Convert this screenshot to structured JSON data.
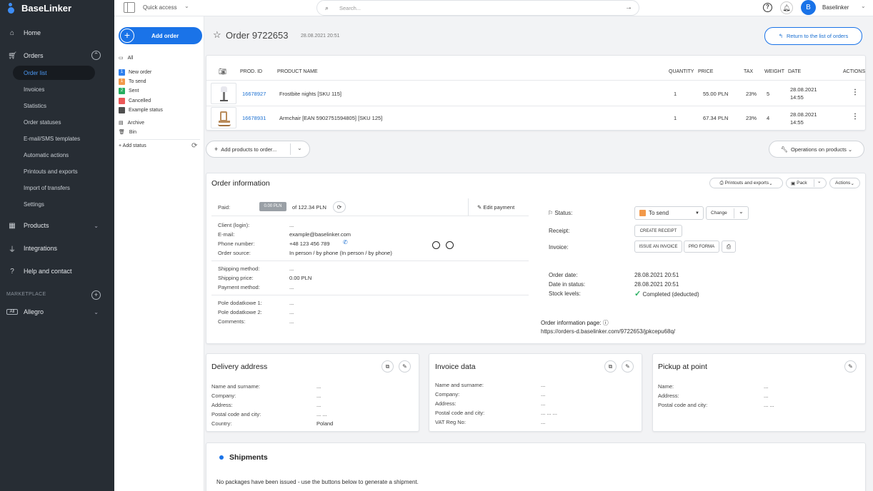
{
  "app": {
    "name": "BaseLinker"
  },
  "sidebar": {
    "home": "Home",
    "orders": "Orders",
    "orders_sub": [
      "Order list",
      "Invoices",
      "Statistics",
      "Order statuses",
      "E-mail/SMS templates",
      "Automatic actions",
      "Printouts and exports",
      "Import of transfers",
      "Settings"
    ],
    "products": "Products",
    "integrations": "Integrations",
    "help": "Help and contact",
    "marketplace_label": "MARKETPLACE",
    "allegro_badge": "All",
    "allegro": "Allegro"
  },
  "topbar": {
    "quick_access": "Quick access",
    "search_placeholder": "Search...",
    "user_initial": "B",
    "user_name": "Baselinker"
  },
  "status_panel": {
    "add_order": "Add order",
    "all": "All",
    "statuses": [
      {
        "num": "1",
        "label": "New order",
        "color": "#2f80ed"
      },
      {
        "num": "1",
        "label": "To send",
        "color": "#f2994a"
      },
      {
        "num": "2",
        "label": "Sent",
        "color": "#27ae60"
      },
      {
        "num": "",
        "label": "Cancelled",
        "color": "#eb5757"
      },
      {
        "num": "",
        "label": "Example status",
        "color": "#4f4f4f"
      }
    ],
    "archive": "Archive",
    "bin": "Bin",
    "add_status": "+ Add status"
  },
  "order_header": {
    "title": "Order 9722653",
    "date": "28.08.2021 20:51",
    "return_button": "Return to the list of orders"
  },
  "products_table": {
    "headers": [
      "PROD. ID",
      "PRODUCT NAME",
      "QUANTITY",
      "PRICE",
      "TAX",
      "WEIGHT",
      "DATE",
      "ACTIONS"
    ],
    "rows": [
      {
        "id": "16678927",
        "name": "Frostbite nights [SKU 115]",
        "qty": "1",
        "price": "55.00 PLN",
        "tax": "23%",
        "weight": "5",
        "date": "28.08.2021",
        "time": "14:55"
      },
      {
        "id": "16678931",
        "name": "Armchair [EAN 5902751594805] [SKU 125]",
        "qty": "1",
        "price": "67.34 PLN",
        "tax": "23%",
        "weight": "4",
        "date": "28.08.2021",
        "time": "14:55"
      }
    ],
    "add_products": "Add products to order...",
    "operations": "Operations on products"
  },
  "order_info": {
    "title": "Order information",
    "printouts_btn": "Printouts and exports",
    "pack_btn": "Pack",
    "actions_btn": "Actions",
    "paid_label": "Paid:",
    "paid_amount": "0.00 PLN",
    "paid_of": "of 122.34 PLN",
    "edit_payment": "Edit payment",
    "client_login_label": "Client (login):",
    "client_login": "...",
    "email_label": "E-mail:",
    "email": "example@baselinker.com",
    "phone_label": "Phone number:",
    "phone": "+48 123 456 789",
    "source_label": "Order source:",
    "source": "In person / by phone (In person / by phone)",
    "ship_method_label": "Shipping method:",
    "ship_method": "...",
    "ship_price_label": "Shipping price:",
    "ship_price": "0.00 PLN",
    "pay_method_label": "Payment method:",
    "pay_method": "...",
    "extra1_label": "Pole dodatkowe 1:",
    "extra1": "...",
    "extra2_label": "Pole dodatkowe 2:",
    "extra2": "...",
    "comments_label": "Comments:",
    "comments": "...",
    "status_label": "Status:",
    "status_value": "To send",
    "change_btn": "Change",
    "receipt_label": "Receipt:",
    "create_receipt": "CREATE RECEIPT",
    "invoice_label": "Invoice:",
    "issue_invoice": "ISSUE AN INVOICE",
    "pro_forma": "PRO FORMA",
    "order_date_label": "Order date:",
    "order_date": "28.08.2021 20:51",
    "date_status_label": "Date in status:",
    "date_status": "28.08.2021 20:51",
    "stock_label": "Stock levels:",
    "stock": "Completed (deducted)",
    "info_page_label": "Order information page:",
    "info_page_url": "https://orders-d.baselinker.com/9722653/jpkcepu68q/"
  },
  "delivery": {
    "title": "Delivery address",
    "fields": [
      {
        "label": "Name and surname:",
        "value": "..."
      },
      {
        "label": "Company:",
        "value": "..."
      },
      {
        "label": "Address:",
        "value": "..."
      },
      {
        "label": "Postal code and city:",
        "value": "...     ..."
      },
      {
        "label": "Country:",
        "value": "Poland"
      }
    ]
  },
  "invoice_data": {
    "title": "Invoice data",
    "fields": [
      {
        "label": "Name and surname:",
        "value": "..."
      },
      {
        "label": "Company:",
        "value": "..."
      },
      {
        "label": "Address:",
        "value": "..."
      },
      {
        "label": "Postal code and city:",
        "value": "...     ...     ..."
      },
      {
        "label": "VAT Reg No:",
        "value": "..."
      }
    ]
  },
  "pickup": {
    "title": "Pickup at point",
    "fields": [
      {
        "label": "Name:",
        "value": "..."
      },
      {
        "label": "Address:",
        "value": "..."
      },
      {
        "label": "Postal code and city:",
        "value": "...     ..."
      }
    ]
  },
  "shipments": {
    "title": "Shipments",
    "note": "No packages have been issued - use the buttons below to generate a shipment."
  },
  "colors": {
    "accent": "#1a73e8",
    "sidebar": "#272d34",
    "to_send": "#f2994a"
  }
}
